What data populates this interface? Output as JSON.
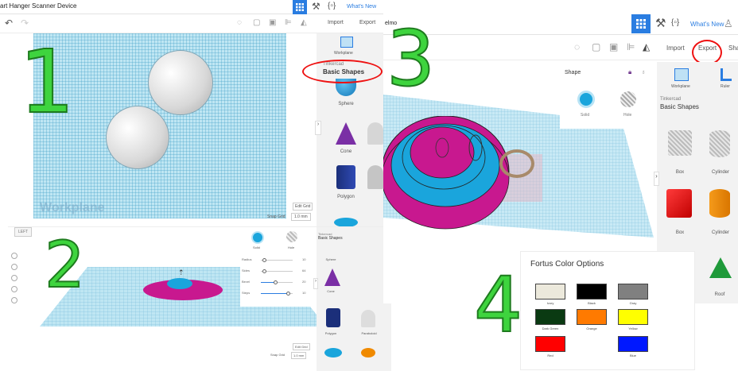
{
  "panel1": {
    "title": "art Hanger Scanner Device",
    "whats_new": "What's New",
    "import": "Import",
    "export": "Export",
    "workplane": "Workplane",
    "library_small": "Tinkercad",
    "library_title": "Basic Shapes",
    "shapes": [
      "Sphere",
      "Cone",
      "Polygon"
    ],
    "workplane_watermark": "Workplane",
    "edit_grid": "Edit Grid",
    "snap_grid_label": "Snap Grid",
    "snap_grid_value": "1.0 mm",
    "number": "1"
  },
  "panel2": {
    "left_label": "LEFT",
    "solid": "Solid",
    "hole": "Hole",
    "sliders": [
      {
        "label": "Radius",
        "value": "10"
      },
      {
        "label": "Sides",
        "value": "64"
      },
      {
        "label": "Bevel",
        "value": "20"
      },
      {
        "label": "Steps",
        "value": "10"
      }
    ],
    "library_small": "Tinkercad",
    "library_title": "Basic Shapes",
    "shapes": [
      "Sphere",
      "Cone",
      "Polygon",
      "Paraboloid"
    ],
    "edit_grid": "Edit Grid",
    "snap_grid_label": "Snap Grid",
    "snap_grid_value": "1.0 mm",
    "number": "2"
  },
  "panel3": {
    "title": "elmo",
    "whats_new": "What's New",
    "import": "Import",
    "export": "Export",
    "share": "Sha",
    "shape_label": "Shape",
    "solid": "Solid",
    "hole": "Hole",
    "workplane": "Workplane",
    "ruler": "Ruler",
    "library_small": "Tinkercad",
    "library_title": "Basic Shapes",
    "shapes": [
      "Box",
      "Cylinder",
      "Box",
      "Cylinder",
      "Roof"
    ],
    "number": "3"
  },
  "panel4": {
    "title": "Fortus Color Options",
    "colors": [
      {
        "name": "Ivory",
        "hex": "#ece9dc"
      },
      {
        "name": "Black",
        "hex": "#000000"
      },
      {
        "name": "Gray",
        "hex": "#808080"
      },
      {
        "name": "Dark Green",
        "hex": "#0a3a12"
      },
      {
        "name": "Orange",
        "hex": "#ff7a00"
      },
      {
        "name": "Yellow",
        "hex": "#ffff00"
      },
      {
        "name": "Red",
        "hex": "#ff0000"
      },
      {
        "name": "Blue",
        "hex": "#0018ff"
      }
    ],
    "number": "4"
  },
  "colors": {
    "accent_blue": "#2a7de1",
    "magenta": "#c8188f",
    "cyan": "#1aa5dc",
    "green_number": "#3ed43e",
    "annotation_red": "#e11111"
  }
}
